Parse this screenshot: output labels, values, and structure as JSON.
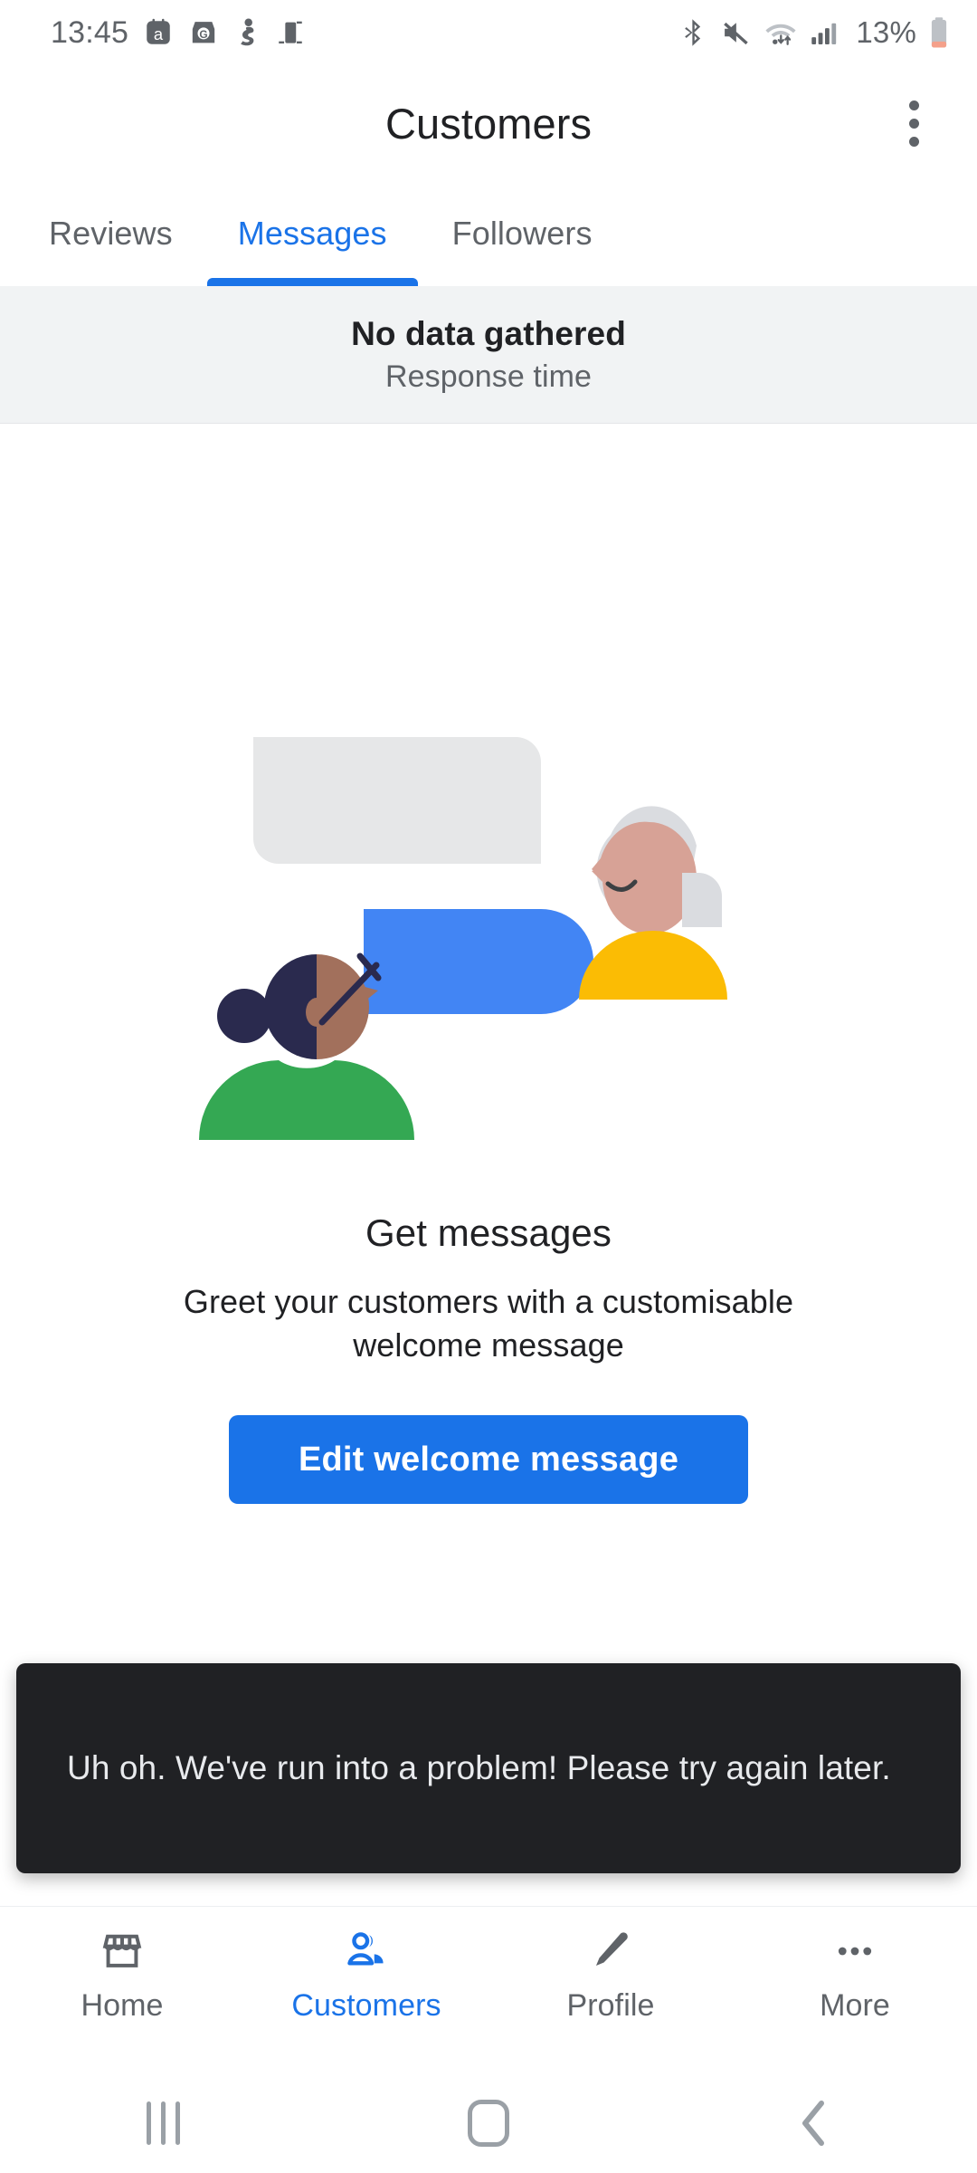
{
  "statusbar": {
    "time": "13:45",
    "left_icons": [
      "amazon-alexa-icon",
      "google-business-icon",
      "person-walk-icon",
      "device-icon"
    ],
    "right_icons": [
      "bluetooth-icon",
      "volume-mute-icon",
      "wifi-icon",
      "signal-bars-icon"
    ],
    "battery_percent": "13%",
    "battery_level": 13,
    "battery_color": "#f4a08a"
  },
  "appbar": {
    "title": "Customers",
    "overflow_label": "More options"
  },
  "tabs": [
    {
      "label": "Reviews",
      "active": false
    },
    {
      "label": "Messages",
      "active": true
    },
    {
      "label": "Followers",
      "active": false
    }
  ],
  "banner": {
    "title": "No data gathered",
    "subtitle": "Response time"
  },
  "empty_state": {
    "illustration": "two-people-chat-bubbles-illustration",
    "title": "Get messages",
    "subtitle": "Greet your customers with a customisable welcome message",
    "cta_label": "Edit welcome message"
  },
  "snackbar": {
    "message": "Uh oh. We've run into a problem! Please try again later."
  },
  "bottom_nav": [
    {
      "label": "Home",
      "icon": "storefront-icon",
      "active": false
    },
    {
      "label": "Customers",
      "icon": "people-icon",
      "active": true
    },
    {
      "label": "Profile",
      "icon": "pencil-icon",
      "active": false
    },
    {
      "label": "More",
      "icon": "more-dots-icon",
      "active": false
    }
  ],
  "system_nav": {
    "recents": "recents-icon",
    "home": "home-icon",
    "back": "back-icon"
  },
  "colors": {
    "accent": "#1a73e8",
    "text_primary": "#202124",
    "text_secondary": "#5f6368",
    "banner_bg": "#f1f3f4",
    "snackbar_bg": "#202124"
  }
}
